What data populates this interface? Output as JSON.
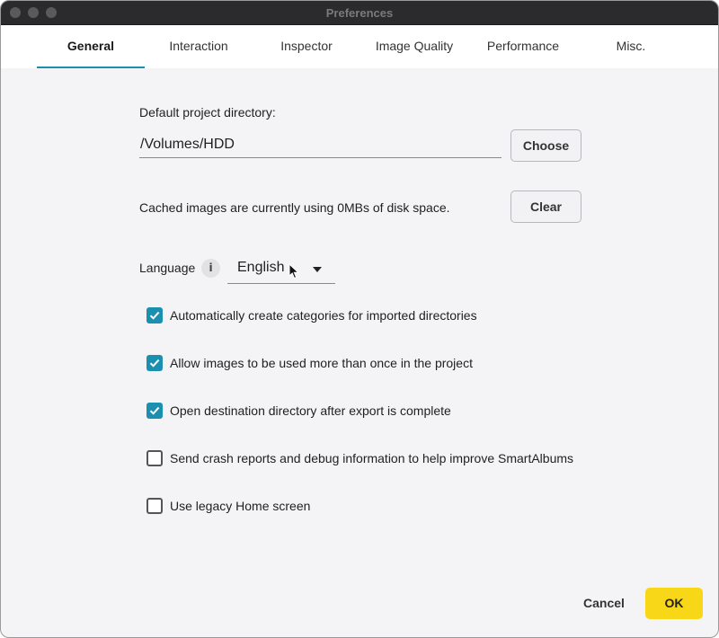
{
  "window": {
    "title": "Preferences"
  },
  "tabs": [
    {
      "label": "General",
      "active": true
    },
    {
      "label": "Interaction",
      "active": false
    },
    {
      "label": "Inspector",
      "active": false
    },
    {
      "label": "Image Quality",
      "active": false
    },
    {
      "label": "Performance",
      "active": false
    },
    {
      "label": "Misc.",
      "active": false
    }
  ],
  "project_dir": {
    "label": "Default project directory:",
    "value": "/Volumes/HDD",
    "choose_label": "Choose"
  },
  "cache": {
    "text": "Cached images are currently using 0MBs of disk space.",
    "clear_label": "Clear"
  },
  "language": {
    "label": "Language",
    "info_glyph": "i",
    "selected": "English"
  },
  "options": [
    {
      "label": "Automatically create categories for imported directories",
      "checked": true
    },
    {
      "label": "Allow images to be used more than once in the project",
      "checked": true
    },
    {
      "label": "Open destination directory after export is complete",
      "checked": true
    },
    {
      "label": "Send crash reports and debug information to help improve SmartAlbums",
      "checked": false
    },
    {
      "label": "Use legacy Home screen",
      "checked": false
    }
  ],
  "footer": {
    "cancel_label": "Cancel",
    "ok_label": "OK"
  },
  "colors": {
    "accent": "#1a8fb0",
    "ok_button": "#f7d717",
    "titlebar": "#2b2b2d"
  }
}
